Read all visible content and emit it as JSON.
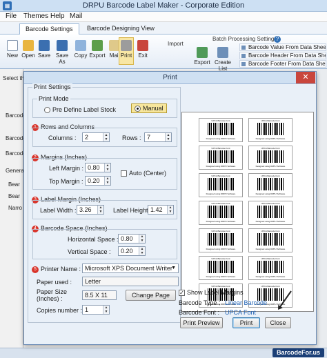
{
  "window": {
    "title": "DRPU Barcode Label Maker - Corporate Edition"
  },
  "menu": [
    "File",
    "Themes",
    "Help",
    "Mail"
  ],
  "ribbon_tabs": [
    "Barcode Settings",
    "Barcode Designing View"
  ],
  "toolbar": [
    "New",
    "Open",
    "Save",
    "Save As",
    "Copy",
    "Export",
    "Mail",
    "Print",
    "Exit"
  ],
  "import_group": {
    "title": "Import",
    "export_label": "Export",
    "create_list_label": "Create List"
  },
  "batch": {
    "title": "Batch Processing Settings",
    "items": [
      "Barcode Value From Data Sheet",
      "Barcode Header From Data Sheet",
      "Barcode Footer From Data Sheet"
    ]
  },
  "background_labels": [
    "Select th",
    "Barcode",
    "Barcode",
    "Barcode",
    "Genera",
    "Bear",
    "Bear",
    "Narro"
  ],
  "dialog": {
    "title": "Print",
    "close_glyph": "✕",
    "settings_legend": "Print Settings",
    "print_mode": {
      "legend": "Print Mode",
      "options": [
        "Pre Define Label Stock",
        "Manual"
      ],
      "selected": "Manual"
    },
    "rows_columns": {
      "num": "1",
      "legend": "Rows and Columns",
      "columns_label": "Columns :",
      "columns": "2",
      "rows_label": "Rows :",
      "rows": "7"
    },
    "margins": {
      "num": "2",
      "legend": "Margins (Inches)",
      "left_label": "Left Margin :",
      "left": "0.80",
      "top_label": "Top Margin :",
      "top": "0.20",
      "auto_label": "Auto (Center)"
    },
    "label_margin": {
      "num": "3",
      "legend": "Label Margin (Inches)",
      "width_label": "Label Width :",
      "width": "3.26",
      "height_label": "Label Height :",
      "height": "1.42"
    },
    "barcode_space": {
      "num": "4",
      "legend": "Barcode Space (Inches)",
      "h_label": "Horizontal Space :",
      "h": "0.80",
      "v_label": "Vertical Space :",
      "v": "0.20"
    },
    "printer": {
      "num": "5",
      "label": "Printer Name :",
      "value": "Microsoft XPS Document Writer",
      "paper_used_label": "Paper used :",
      "paper_used": "Letter",
      "paper_size_label": "Paper Size\n(Inches) :",
      "paper_size": "8.5 X 11",
      "change_page": "Change Page",
      "copies_label": "Copies number :",
      "copies": "1"
    },
    "show_margins_label": "Show Label Margins",
    "show_margins_checked": true,
    "barcode_type_label": "Barcode Type :",
    "barcode_type": "Linear Barcode",
    "barcode_font_label": "Barcode Font :",
    "barcode_font": "UPCA Font",
    "buttons": {
      "preview": "Print Preview",
      "print": "Print",
      "close": "Close"
    },
    "preview_label": {
      "header": "UPCA Barcode Font",
      "footer": "Designed using DRPU Software"
    }
  },
  "logo": "BarcodeFor.us",
  "colors": {
    "accent": "#2f6fb6",
    "selected_tool": "#f8e6a4",
    "badge": "#d9342b",
    "link_text": "#1a5fb4"
  }
}
